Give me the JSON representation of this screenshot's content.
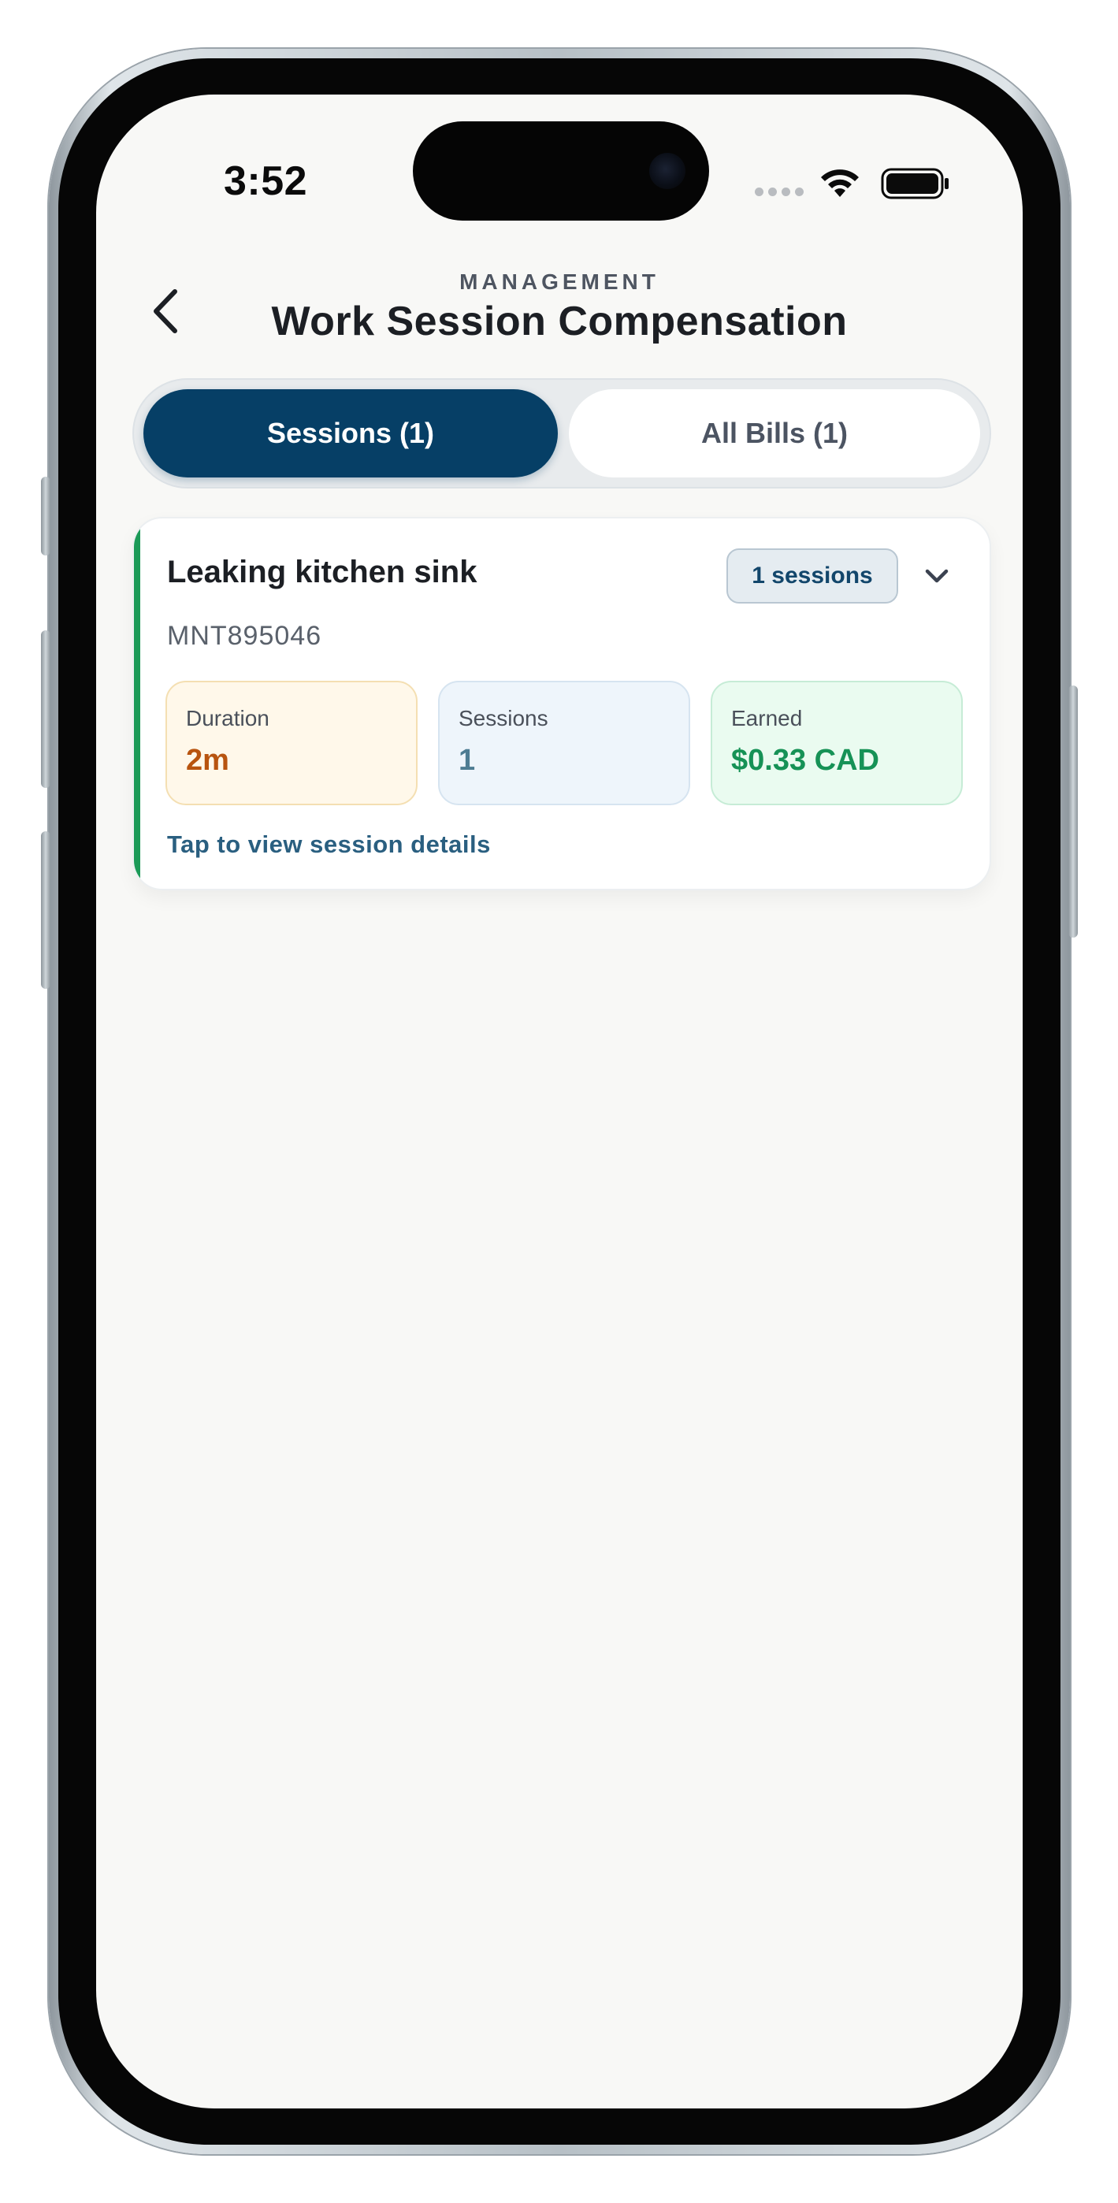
{
  "status_bar": {
    "time": "3:52",
    "icons": [
      "signal-dots-icon",
      "wifi-icon",
      "battery-icon"
    ]
  },
  "header": {
    "back_icon": "chevron-left-icon",
    "subtitle": "MANAGEMENT",
    "title": "Work Session Compensation"
  },
  "tabs": [
    {
      "label": "Sessions (1)",
      "active": true
    },
    {
      "label": "All Bills (1)",
      "active": false
    }
  ],
  "card": {
    "title": "Leaking kitchen sink",
    "id": "MNT895046",
    "badge": "1 sessions",
    "expand_icon": "chevron-down-icon",
    "accent_color": "#1b9a57",
    "stats": {
      "duration": {
        "label": "Duration",
        "value": "2m"
      },
      "sessions": {
        "label": "Sessions",
        "value": "1"
      },
      "earned": {
        "label": "Earned",
        "value": "$0.33 CAD"
      }
    },
    "link": "Tap to view session details"
  },
  "colors": {
    "primary": "#063f66",
    "background": "#f8f8f6",
    "duration": "#b8540f",
    "earned": "#169256"
  }
}
